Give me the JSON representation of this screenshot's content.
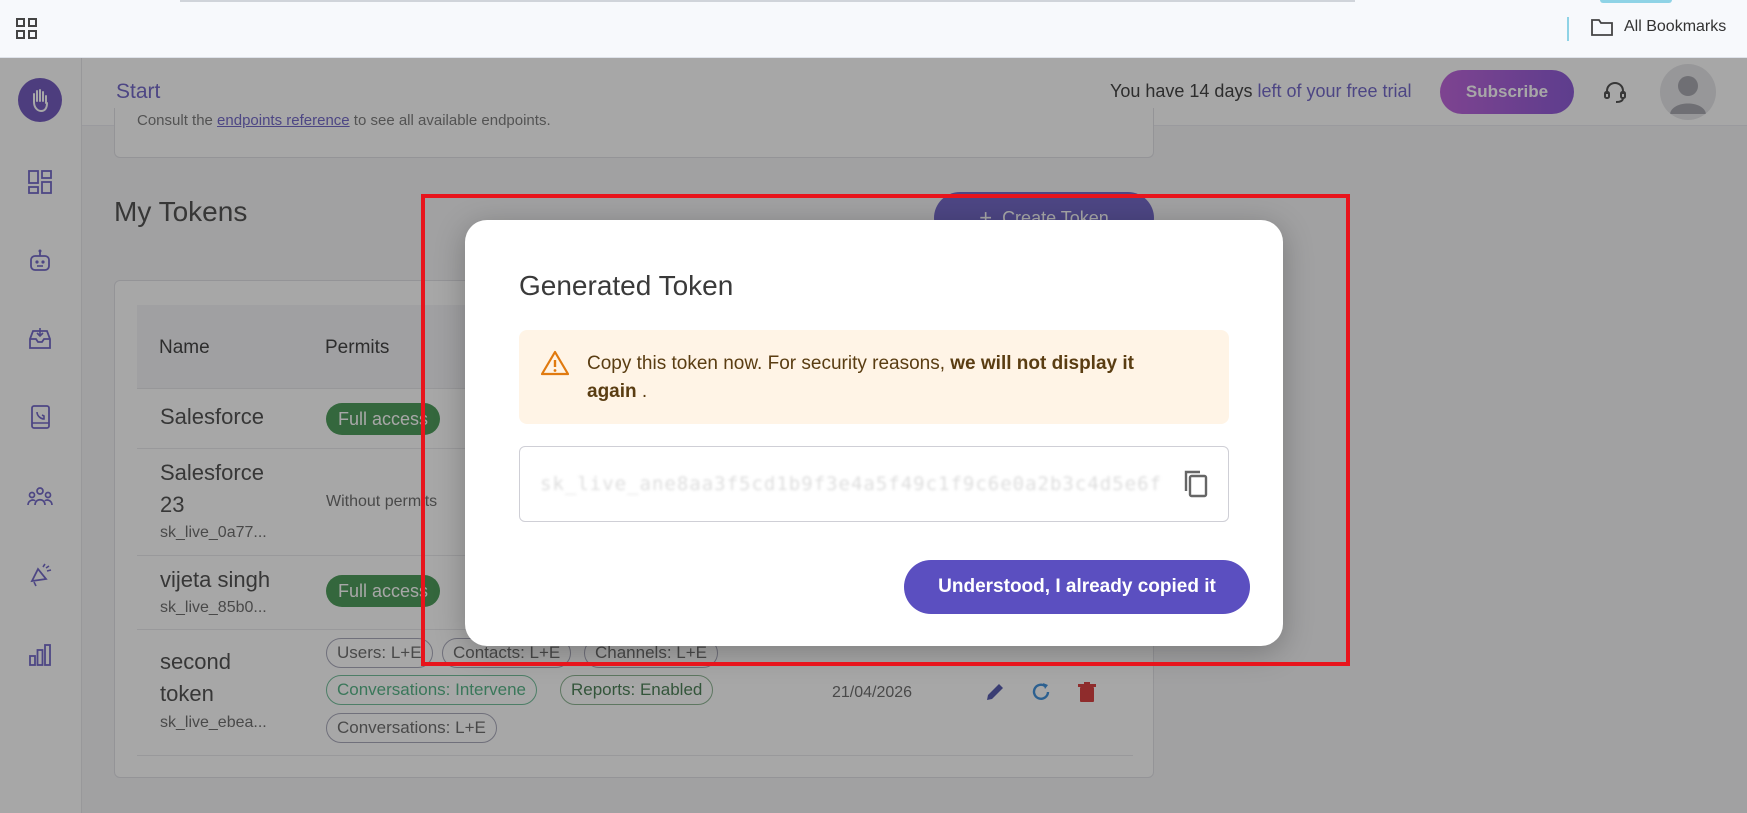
{
  "browser": {
    "bookmarks_label": "All Bookmarks",
    "icons": [
      "apps-grid-icon",
      "folder-icon"
    ]
  },
  "sidebar": {
    "items": [
      {
        "name": "dashboard",
        "icon": "dashboard-icon"
      },
      {
        "name": "bot",
        "icon": "robot-icon"
      },
      {
        "name": "inbox",
        "icon": "inbox-icon"
      },
      {
        "name": "contacts",
        "icon": "contact-book-icon"
      },
      {
        "name": "team",
        "icon": "users-icon"
      },
      {
        "name": "campaigns",
        "icon": "megaphone-icon"
      },
      {
        "name": "reports",
        "icon": "bar-chart-icon"
      }
    ]
  },
  "header": {
    "breadcrumb": "Start",
    "trial_prefix": "You have 14 days",
    "trial_suffix": " left of your free trial",
    "subscribe_label": "Subscribe"
  },
  "content": {
    "reference_prefix": "Consult the ",
    "reference_link": "endpoints reference",
    "reference_suffix": " to see all available endpoints.",
    "section_title": "My Tokens",
    "create_label": "Create Token",
    "columns": [
      "Name",
      "Permits"
    ],
    "rows": [
      {
        "name": "Salesforce",
        "sub": "",
        "permit": "Full access"
      },
      {
        "name_line1": "Salesforce",
        "name_line2": "23",
        "sub": "sk_live_0a77...",
        "permit": "Without permits"
      },
      {
        "name": "vijeta singh",
        "sub": "sk_live_85b0...",
        "permit": "Full access"
      },
      {
        "name_line1": "second",
        "name_line2": "token",
        "sub": "sk_live_ebea...",
        "chips": [
          "Users: L+E",
          "Contacts: L+E",
          "Channels: L+E",
          "Conversations: Intervene",
          "Reports: Enabled",
          "Conversations: L+E"
        ],
        "date": "21/04/2026"
      }
    ]
  },
  "modal": {
    "title": "Generated Token",
    "alert_text": "Copy this token now. For security reasons, ",
    "alert_bold": "we will not display it again",
    "alert_end": " .",
    "token_value": "sk_live_ane8aa3f5cd1b9f3e4a5f49c1f9c6e0a2b3c4d5e6f7",
    "confirm_label": "Understood, I already copied it"
  },
  "colors": {
    "brand": "#5b4fc0",
    "alert_bg": "#fff4e6",
    "alert_icon": "#e07a10",
    "full_access": "#2e8b3e",
    "highlight": "#e8141c"
  }
}
